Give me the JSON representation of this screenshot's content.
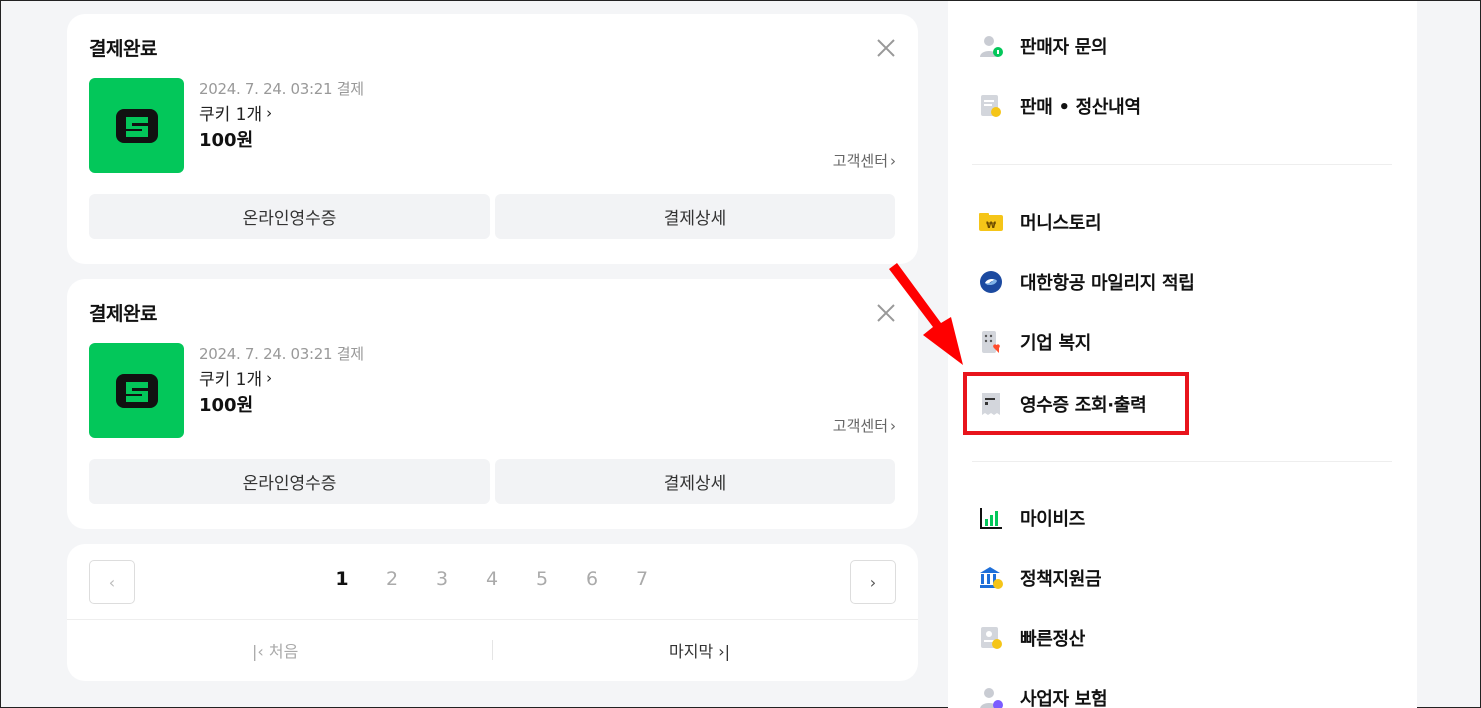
{
  "orders": [
    {
      "status": "결제완료",
      "date": "2024. 7. 24. 03:21 결제",
      "item": "쿠키 1개",
      "price": "100원",
      "cs_link": "고객센터",
      "receipt_button": "온라인영수증",
      "detail_button": "결제상세"
    },
    {
      "status": "결제완료",
      "date": "2024. 7. 24. 03:21 결제",
      "item": "쿠키 1개",
      "price": "100원",
      "cs_link": "고객센터",
      "receipt_button": "온라인영수증",
      "detail_button": "결제상세"
    }
  ],
  "pagination": {
    "pages": [
      "1",
      "2",
      "3",
      "4",
      "5",
      "6",
      "7"
    ],
    "current": "1",
    "first_label": "처음",
    "last_label": "마지막"
  },
  "side_menu": {
    "group1": [
      {
        "label": "판매자 문의",
        "icon": "seller-inquiry-icon"
      },
      {
        "label": "판매 • 정산내역",
        "icon": "sales-settlement-icon"
      }
    ],
    "group2": [
      {
        "label": "머니스토리",
        "icon": "money-story-icon"
      },
      {
        "label": "대한항공 마일리지 적립",
        "icon": "korean-air-icon"
      },
      {
        "label": "기업 복지",
        "icon": "corporate-welfare-icon"
      },
      {
        "label": "영수증 조회·출력",
        "icon": "receipt-icon"
      }
    ],
    "group3": [
      {
        "label": "마이비즈",
        "icon": "mybiz-chart-icon"
      },
      {
        "label": "정책지원금",
        "icon": "policy-fund-icon"
      },
      {
        "label": "빠른정산",
        "icon": "fast-settlement-icon"
      },
      {
        "label": "사업자 보험",
        "icon": "business-insurance-icon"
      }
    ]
  },
  "colors": {
    "brand_green": "#03c75a",
    "highlight_red": "#e8141c",
    "background": "#f4f5f7"
  }
}
